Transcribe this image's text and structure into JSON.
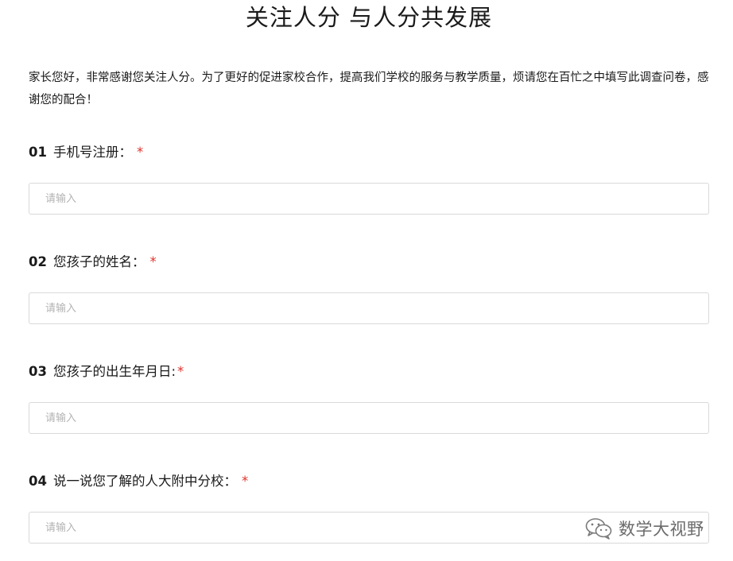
{
  "header": {
    "title": "关注人分 与人分共发展"
  },
  "intro": {
    "text": "家长您好，非常感谢您关注人分。为了更好的促进家校合作，提高我们学校的服务与教学质量，烦请您在百忙之中填写此调查问卷，感谢您的配合！"
  },
  "questions": [
    {
      "number": "01",
      "label": "手机号注册：",
      "required_mark": "*",
      "placeholder": "请输入",
      "value": ""
    },
    {
      "number": "02",
      "label": "您孩子的姓名：",
      "required_mark": "*",
      "placeholder": "请输入",
      "value": ""
    },
    {
      "number": "03",
      "label": "您孩子的出生年月日:",
      "required_mark": "*",
      "placeholder": "请输入",
      "value": ""
    },
    {
      "number": "04",
      "label": "说一说您了解的人大附中分校：",
      "required_mark": "*",
      "placeholder": "请输入",
      "value": ""
    }
  ],
  "watermark": {
    "text": "数学大视野",
    "icon": "wechat-icon"
  },
  "colors": {
    "required": "#e0322c",
    "input_border": "#d9d9d9",
    "placeholder": "#b3b3b3"
  }
}
